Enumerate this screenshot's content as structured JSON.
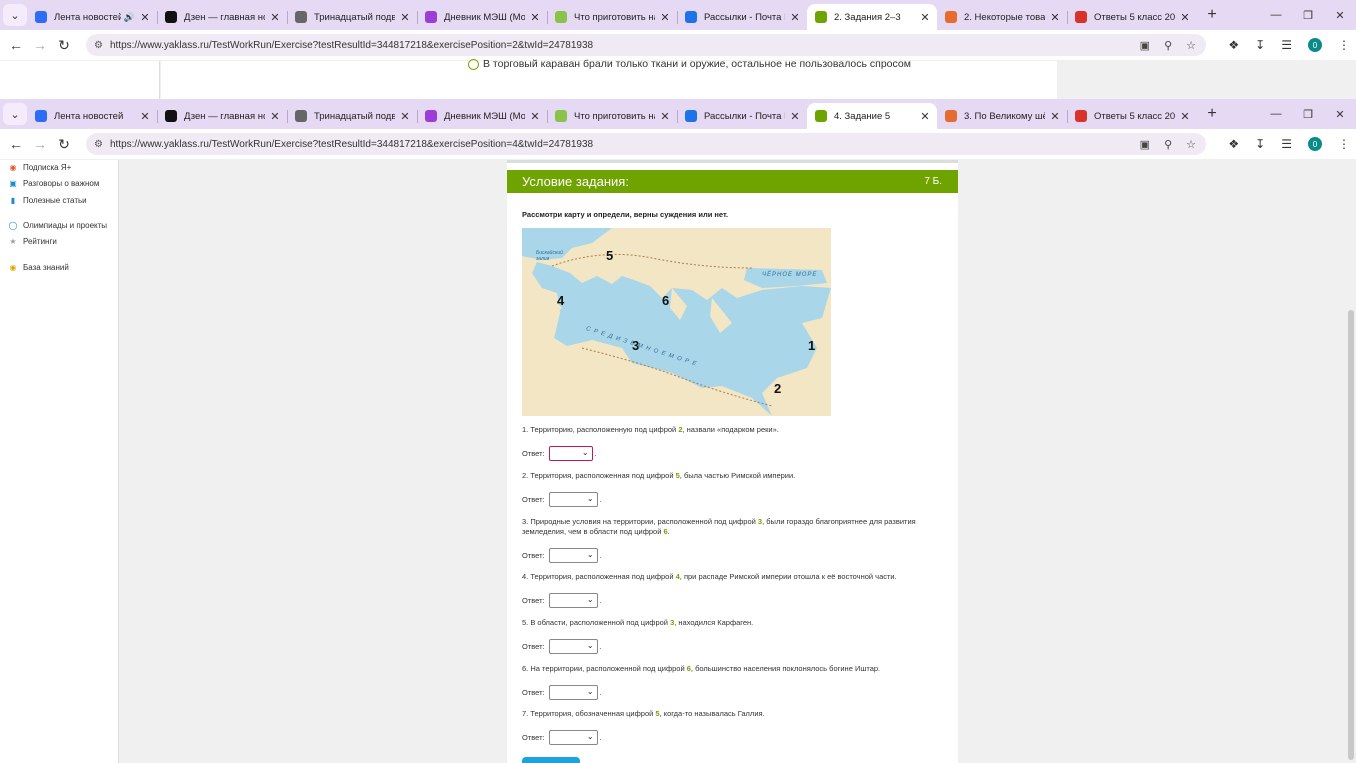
{
  "back_window": {
    "tabs": [
      {
        "title": "Лента новостей",
        "icon": "video-icon",
        "color": "#2d6df6",
        "audio": true
      },
      {
        "title": "Дзен — главная нов",
        "icon": "dzen-icon",
        "color": "#111111"
      },
      {
        "title": "Тринадцатый подви",
        "icon": "globe-icon",
        "color": "#666666"
      },
      {
        "title": "Дневник МЭШ (Мос",
        "icon": "mesh-icon",
        "color": "#9b3dd6"
      },
      {
        "title": "Что приготовить на",
        "icon": "star-icon",
        "color": "#8bc34a"
      },
      {
        "title": "Рассылки - Почта М",
        "icon": "mail-icon",
        "color": "#1e73e8"
      },
      {
        "title": "2. Задания 2–3",
        "icon": "yaklass-icon",
        "color": "#6fa300",
        "active": true
      },
      {
        "title": "2. Некоторые товар",
        "icon": "gd-icon",
        "color": "#e66b2f"
      },
      {
        "title": "Ответы 5 класс 2025",
        "icon": "shoe-icon",
        "color": "#d8322b"
      }
    ],
    "url": "https://www.yaklass.ru/TestWorkRun/Exercise?testResultId=344817218&exercisePosition=2&twId=24781938",
    "option_text": "В торговый караван брали только ткани и оружие, остальное не пользовалось спросом"
  },
  "front_window": {
    "tabs": [
      {
        "title": "Лента новостей",
        "icon": "video-icon",
        "color": "#2d6df6"
      },
      {
        "title": "Дзен — главная нов",
        "icon": "dzen-icon",
        "color": "#111111"
      },
      {
        "title": "Тринадцатый подви",
        "icon": "globe-icon",
        "color": "#666666"
      },
      {
        "title": "Дневник МЭШ (Мос",
        "icon": "mesh-icon",
        "color": "#9b3dd6"
      },
      {
        "title": "Что приготовить на",
        "icon": "star-icon",
        "color": "#8bc34a"
      },
      {
        "title": "Рассылки - Почта М",
        "icon": "mail-icon",
        "color": "#1e73e8"
      },
      {
        "title": "4. Задание 5",
        "icon": "yaklass-icon",
        "color": "#6fa300",
        "active": true
      },
      {
        "title": "3. По Великому шёл",
        "icon": "gd-icon",
        "color": "#e66b2f"
      },
      {
        "title": "Ответы 5 класс 2025",
        "icon": "shoe-icon",
        "color": "#d8322b"
      }
    ],
    "url": "https://www.yaklass.ru/TestWorkRun/Exercise?testResultId=344817218&exercisePosition=4&twId=24781938"
  },
  "sidebar": {
    "items": [
      {
        "label": "Подписка Я+",
        "icon": "plus-badge-icon",
        "color": "#e8572a"
      },
      {
        "label": "Разговоры о важном",
        "icon": "chat-icon",
        "color": "#1a8ccf"
      },
      {
        "label": "Полезные статьи",
        "icon": "bars-icon",
        "color": "#1a8ccf"
      },
      {
        "label": "Олимпиады и проекты",
        "icon": "medal-icon",
        "color": "#1a8ccf"
      },
      {
        "label": "Рейтинги",
        "icon": "star-icon",
        "color": "#9e9e9e"
      },
      {
        "label": "База знаний",
        "icon": "bulb-icon",
        "color": "#e0a800"
      }
    ]
  },
  "task": {
    "header_title": "Условие задания:",
    "points": "7 Б.",
    "intro": "Рассмотри карту и определи, верны суждения или нет.",
    "map_labels": {
      "n1": "1",
      "n2": "2",
      "n3": "3",
      "n4": "4",
      "n5": "5",
      "n6": "6",
      "black_sea": "ЧЁРНОЕ МОРЕ",
      "mediterranean": "С Р Е Д И З Е М Н О Е   М О Р Е",
      "biscay": "Бискайский залив"
    },
    "answer_label": "Ответ:",
    "questions": [
      {
        "pre": "1. Территорию, расположенную под цифрой ",
        "num": "2",
        "post": ", назвали «подарком реки»."
      },
      {
        "pre": "2. Территория, расположенная под цифрой ",
        "num": "5",
        "post": ", была частью Римской империи."
      },
      {
        "pre": "3. Природные условия на территории, расположенной под цифрой ",
        "num": "3",
        "post": ", были гораздо благоприятнее для развития земледелия, чем в области под цифрой ",
        "num2": "6",
        "post2": "."
      },
      {
        "pre": "4. Территория, расположенная под цифрой ",
        "num": "4",
        "post": ", при распаде Римской империи отошла к её восточной части."
      },
      {
        "pre": "5. В области, расположенной под цифрой ",
        "num": "3",
        "post": ", находился Карфаген."
      },
      {
        "pre": "6. На территории, расположенной под цифрой ",
        "num": "6",
        "post": ", большинство населения поклонялось богине Иштар."
      },
      {
        "pre": "7. Территория, обозначенная цифрой ",
        "num": "5",
        "post": ", когда-то называлась Галлия."
      }
    ]
  }
}
